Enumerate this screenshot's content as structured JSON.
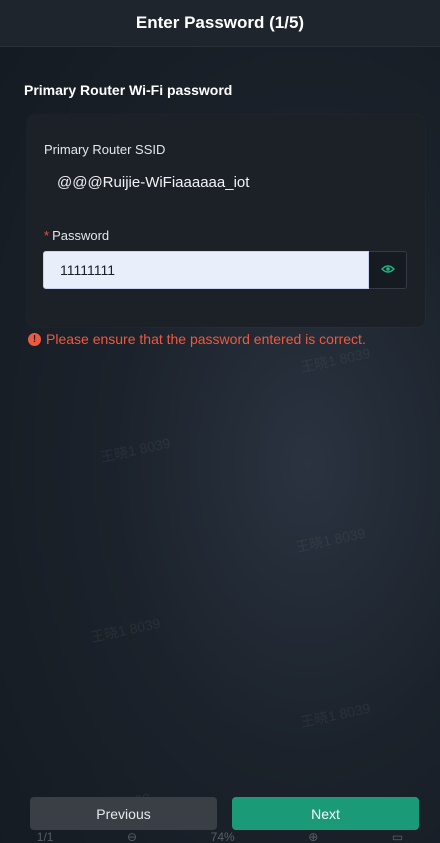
{
  "header": {
    "title": "Enter Password (1/5)"
  },
  "section": {
    "title": "Primary Router Wi-Fi password"
  },
  "form": {
    "ssid_label": "Primary Router SSID",
    "ssid_value": "@@@Ruijie-WiFiaaaaaa_iot",
    "password_required_mark": "*",
    "password_label": "Password",
    "password_value": "11111111",
    "toggle_icon": "eye-icon"
  },
  "error": {
    "icon": "exclamation-circle-icon",
    "message": "Please ensure that the password entered is correct."
  },
  "watermark": {
    "text": "王晓1 8039"
  },
  "footer": {
    "previous_label": "Previous",
    "next_label": "Next"
  },
  "viewer_toolbar": {
    "page_indicator": "1/1",
    "zoom": "74%"
  },
  "colors": {
    "accent": "#1b9a78",
    "error": "#ef5a3f",
    "header_bg": "#1f252c",
    "card_bg": "#1c2128"
  }
}
